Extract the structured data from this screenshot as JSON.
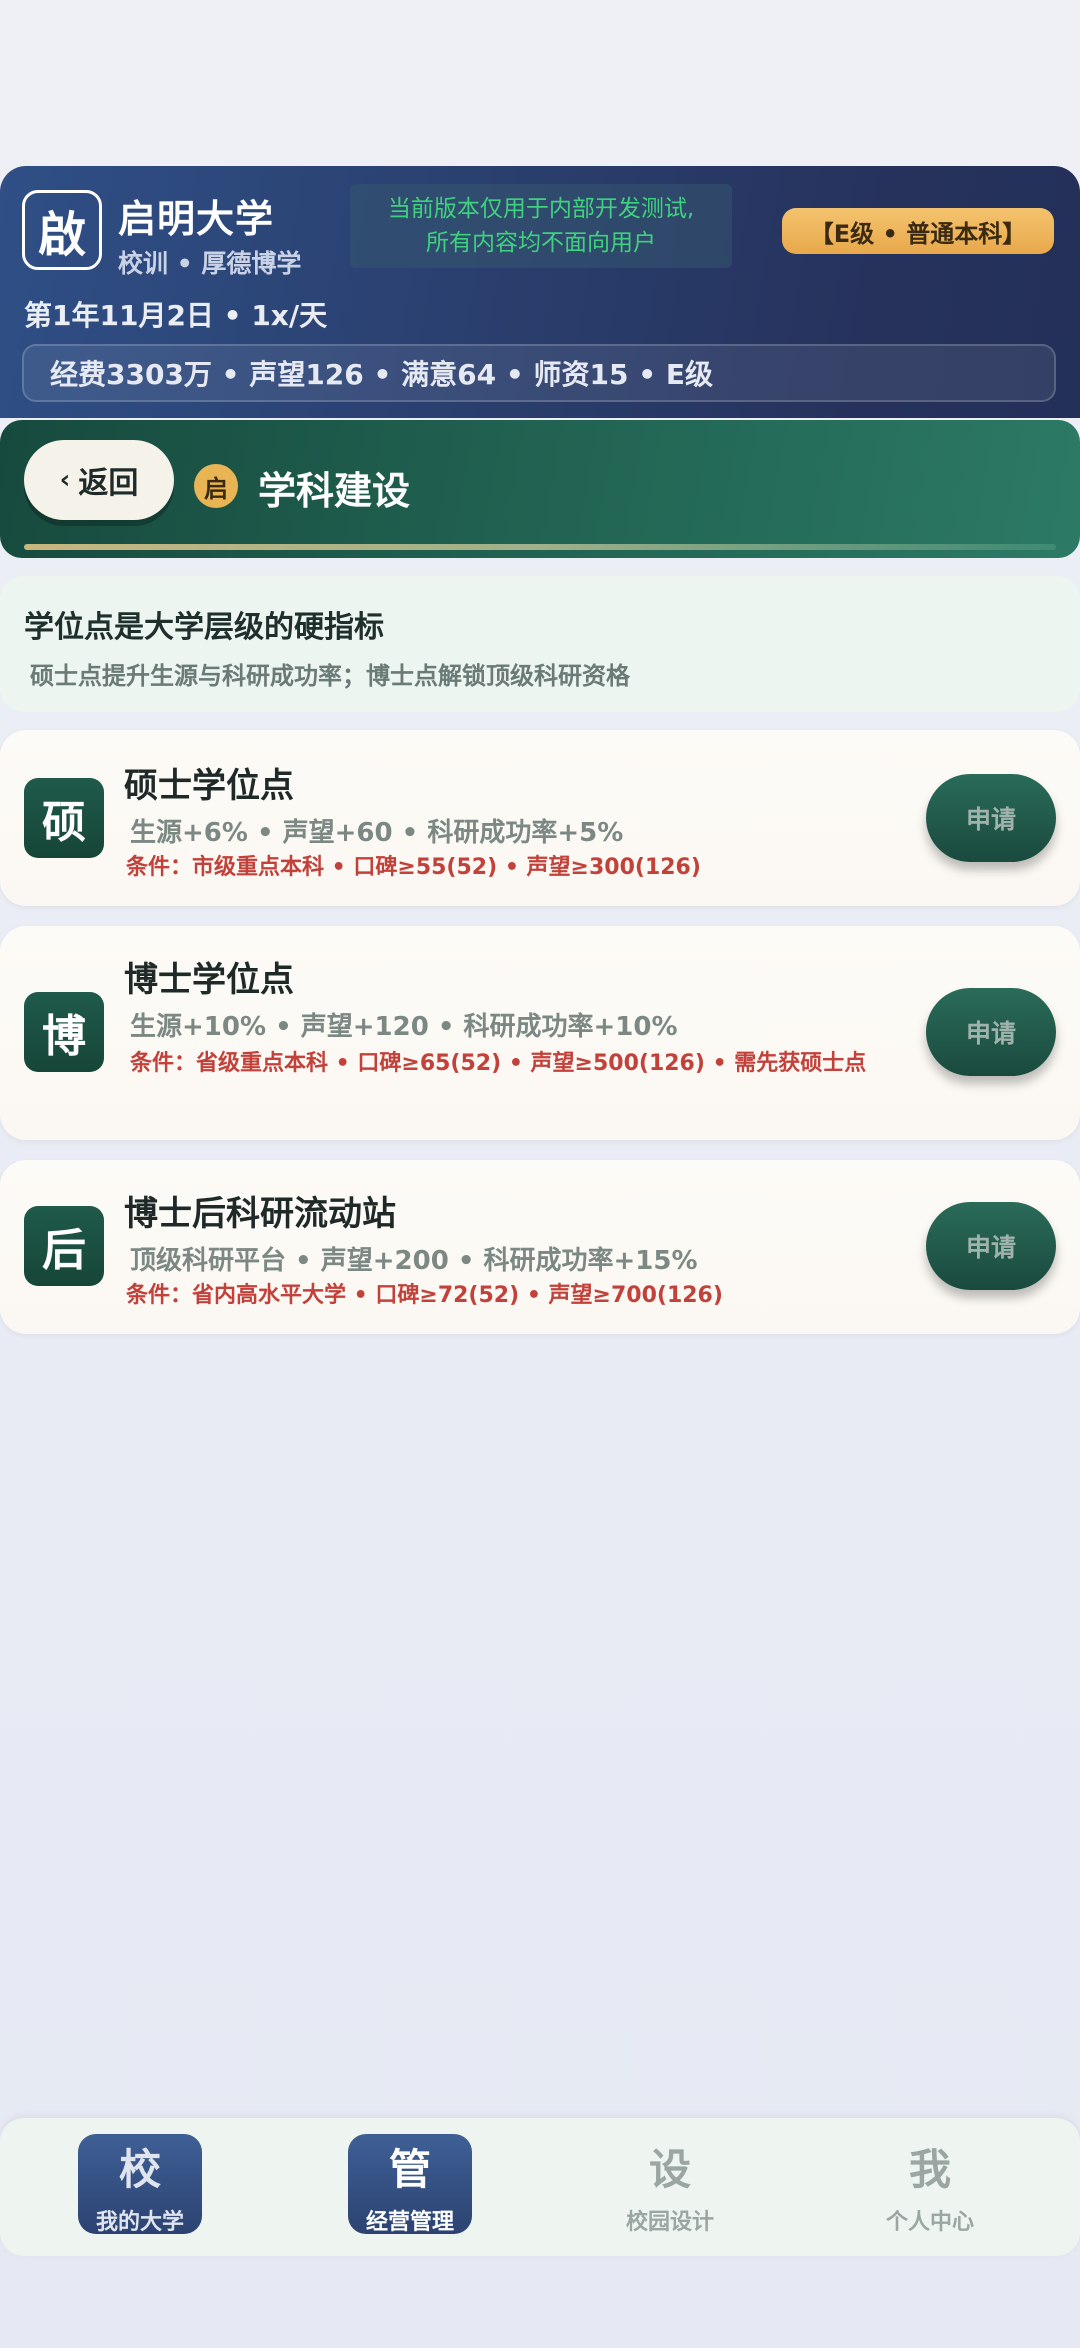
{
  "header": {
    "logo_char": "啟",
    "university_name": "启明大学",
    "motto": "校训 • 厚德博学",
    "notice_line1": "当前版本仅用于内部开发测试,",
    "notice_line2": "所有内容均不面向用户",
    "tier_badge": "【E级 • 普通本科】",
    "date_speed": "第1年11月2日 • 1x/天",
    "stats": "经费3303万 • 声望126 • 满意64 • 师资15 • E级"
  },
  "section": {
    "back_chevron": "‹",
    "back_label": "返回",
    "badge_char": "启",
    "title": "学科建设"
  },
  "info": {
    "title": "学位点是大学层级的硬指标",
    "subtitle": "硕士点提升生源与科研成功率；博士点解锁顶级科研资格"
  },
  "degrees": [
    {
      "icon_char": "硕",
      "title": "硕士学位点",
      "benefit": "生源+6% • 声望+60 • 科研成功率+5%",
      "condition": "条件：市级重点本科 • 口碑≥55(52) • 声望≥300(126)",
      "button": "申请"
    },
    {
      "icon_char": "博",
      "title": "博士学位点",
      "benefit": "生源+10% • 声望+120 • 科研成功率+10%",
      "condition": "条件：省级重点本科 • 口碑≥65(52) • 声望≥500(126) • 需先获硕士点",
      "button": "申请"
    },
    {
      "icon_char": "后",
      "title": "博士后科研流动站",
      "benefit": "顶级科研平台 • 声望+200 • 科研成功率+15%",
      "condition": "条件：省内高水平大学 • 口碑≥72(52) • 声望≥700(126)",
      "button": "申请"
    }
  ],
  "nav": [
    {
      "glyph": "校",
      "label": "我的大学",
      "state": "active"
    },
    {
      "glyph": "管",
      "label": "经营管理",
      "state": "current"
    },
    {
      "glyph": "设",
      "label": "校园设计",
      "state": "inactive"
    },
    {
      "glyph": "我",
      "label": "个人中心",
      "state": "inactive"
    }
  ]
}
